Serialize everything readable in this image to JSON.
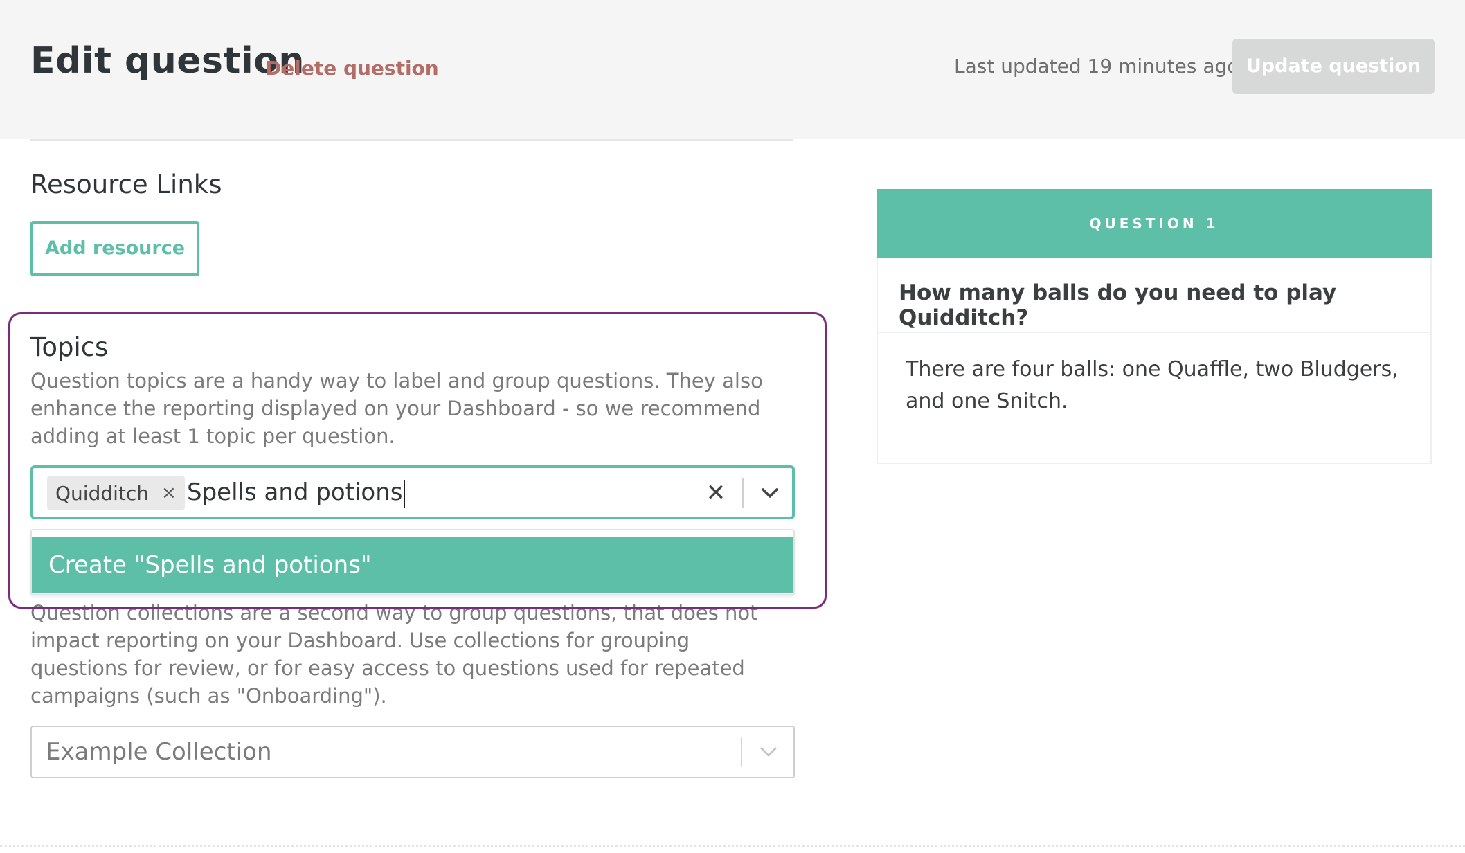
{
  "header": {
    "title": "Edit question",
    "delete_label": "Delete question",
    "last_updated": "Last updated 19 minutes ago",
    "update_label": "Update question"
  },
  "resources": {
    "heading": "Resource Links",
    "add_label": "Add resource"
  },
  "topics": {
    "heading": "Topics",
    "help": "Question topics are a handy way to label and group questions. They also enhance the reporting displayed on your Dashboard - so we recommend adding at least 1 topic per question.",
    "selected_chip": "Quidditch",
    "chip_remove": "×",
    "input_value": "Spells and potions",
    "clear_glyph": "✕",
    "menu_option": "Create \"Spells and potions\""
  },
  "collections": {
    "help": "Question collections are a second way to group questions, that does not impact reporting on your Dashboard. Use collections for grouping questions for review, or for easy access to questions used for repeated campaigns (such as \"Onboarding\").",
    "selected_value": "Example Collection"
  },
  "preview": {
    "header": "QUESTION 1",
    "question": "How many balls do you need to play Quidditch?",
    "answer": "There are four balls: one Quaffle, two Bludgers, and one Snitch."
  },
  "colors": {
    "accent": "#5ebfa9",
    "delete": "#b36d66",
    "highlight": "#7a2b7e",
    "disabled_button": "#d7d9d9"
  }
}
